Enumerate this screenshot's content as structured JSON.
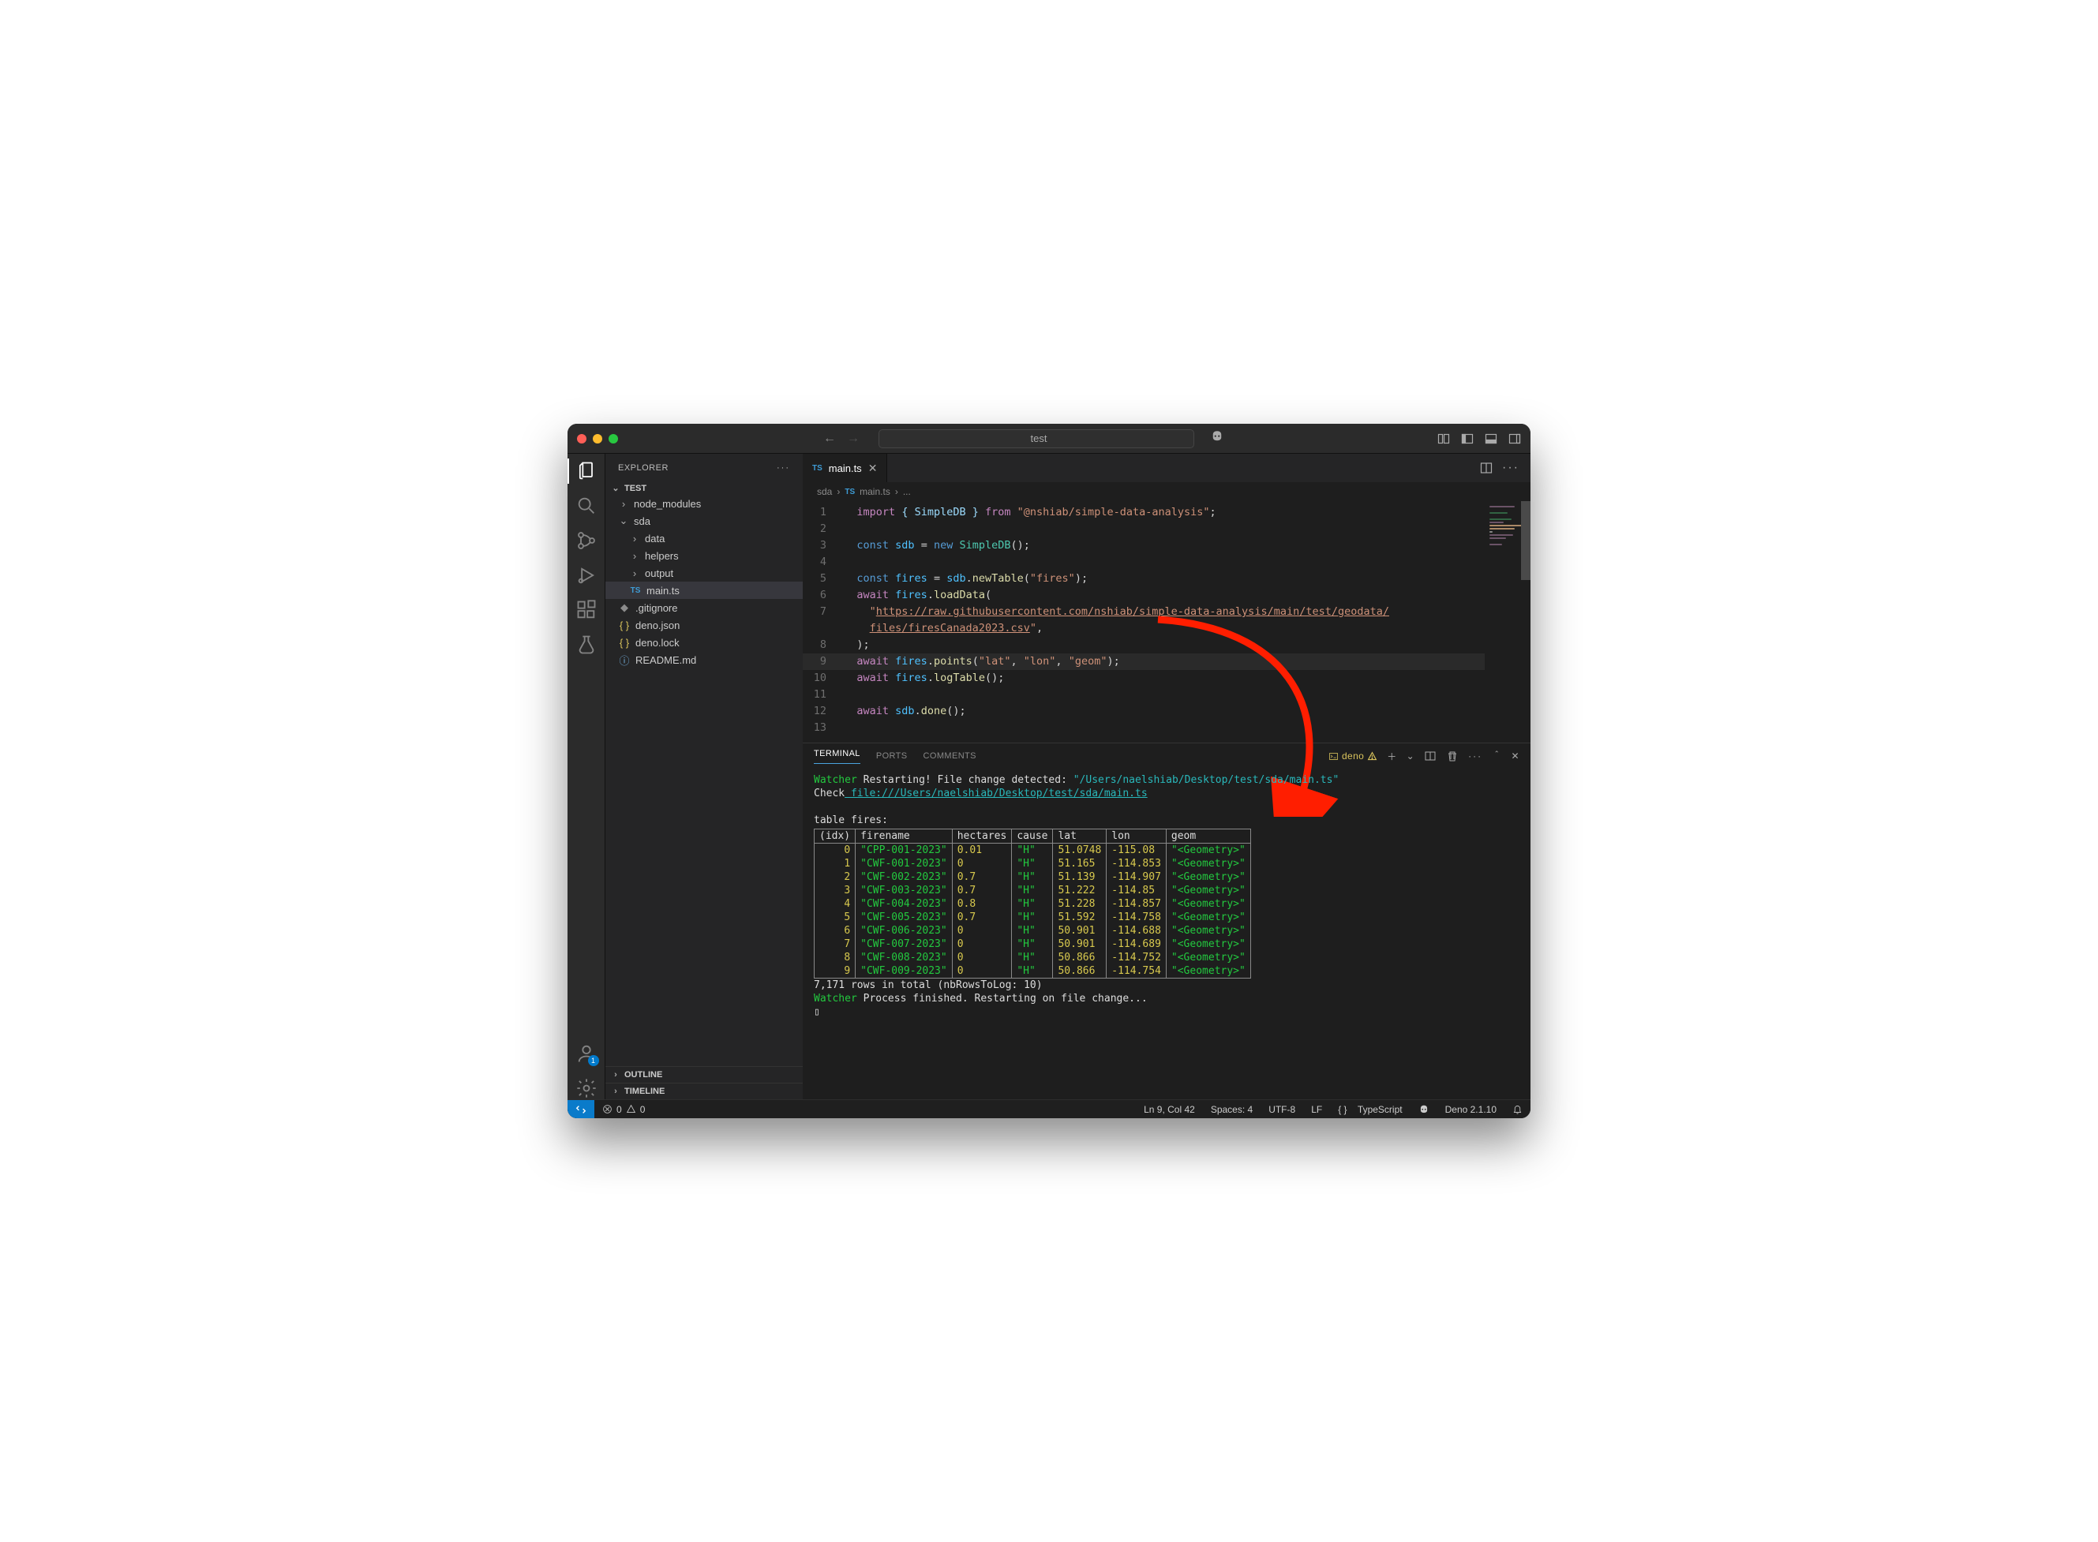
{
  "titlebar": {
    "search": "test"
  },
  "sidebar": {
    "title": "EXPLORER",
    "root": "TEST",
    "tree": [
      {
        "label": "node_modules",
        "indent": 0,
        "chev": "›"
      },
      {
        "label": "sda",
        "indent": 0,
        "chev": "⌄"
      },
      {
        "label": "data",
        "indent": 1,
        "chev": "›"
      },
      {
        "label": "helpers",
        "indent": 1,
        "chev": "›"
      },
      {
        "label": "output",
        "indent": 1,
        "chev": "›"
      },
      {
        "label": "main.ts",
        "indent": 1,
        "icon": "ts",
        "active": true
      },
      {
        "label": ".gitignore",
        "indent": 0,
        "icon": "ignore"
      },
      {
        "label": "deno.json",
        "indent": 0,
        "icon": "json"
      },
      {
        "label": "deno.lock",
        "indent": 0,
        "icon": "json"
      },
      {
        "label": "README.md",
        "indent": 0,
        "icon": "info"
      }
    ],
    "outline": "OUTLINE",
    "timeline": "TIMELINE"
  },
  "tab": {
    "label": "main.ts"
  },
  "breadcrumb": {
    "a": "sda",
    "b": "main.ts",
    "c": "..."
  },
  "editor": {
    "lines": [
      {
        "n": 1,
        "html": "<span class='k-purple'>import</span> <span class='k-prop'>{ SimpleDB }</span> <span class='k-purple'>from</span> <span class='k-str'>\"@nshiab/simple-data-analysis\"</span>;"
      },
      {
        "n": 2,
        "html": ""
      },
      {
        "n": 3,
        "html": "<span class='k-blue'>const</span> <span class='k-const'>sdb</span> = <span class='k-blue'>new</span> <span class='k-cls'>SimpleDB</span>();"
      },
      {
        "n": 4,
        "html": ""
      },
      {
        "n": 5,
        "html": "<span class='k-blue'>const</span> <span class='k-const'>fires</span> = <span class='k-const'>sdb</span>.<span class='k-fn'>newTable</span>(<span class='k-str'>\"fires\"</span>);"
      },
      {
        "n": 6,
        "html": "<span class='k-purple'>await</span> <span class='k-const'>fires</span>.<span class='k-fn'>loadData</span>("
      },
      {
        "n": 7,
        "html": "  <span class='k-str'>\"<span class='underlined'>https://raw.githubusercontent.com/nshiab/simple-data-analysis/main/test/geodata/</span></span>"
      },
      {
        "n": "",
        "html": "  <span class='k-str'><span class='underlined'>files/firesCanada2023.csv</span>\"</span>,"
      },
      {
        "n": 8,
        "html": ");"
      },
      {
        "n": 9,
        "html": "<span class='k-purple'>await</span> <span class='k-const'>fires</span>.<span class='k-fn'>points</span>(<span class='k-str'>\"lat\"</span>, <span class='k-str'>\"lon\"</span>, <span class='k-str'>\"geom\"</span>);",
        "hl": true
      },
      {
        "n": 10,
        "html": "<span class='k-purple'>await</span> <span class='k-const'>fires</span>.<span class='k-fn'>logTable</span>();"
      },
      {
        "n": 11,
        "html": ""
      },
      {
        "n": 12,
        "html": "<span class='k-purple'>await</span> <span class='k-const'>sdb</span>.<span class='k-fn'>done</span>();"
      },
      {
        "n": 13,
        "html": ""
      }
    ]
  },
  "panel": {
    "tabs": {
      "terminal": "TERMINAL",
      "ports": "PORTS",
      "comments": "COMMENTS"
    },
    "runner": "deno",
    "watcher_label": "Watcher",
    "watcher_msg": " Restarting! File change detected: ",
    "watcher_path": "\"/Users/naelshiab/Desktop/test/sda/main.ts\"",
    "check_label": "Check",
    "check_path": " file:///Users/naelshiab/Desktop/test/sda/main.ts",
    "table_label": "table fires:",
    "columns": [
      "(idx)",
      "firename",
      "hectares",
      "cause",
      "lat",
      "lon",
      "geom"
    ],
    "rows": [
      [
        0,
        "\"CPP-001-2023\"",
        "0.01",
        "\"H\"",
        "51.0748",
        "-115.08",
        "\"<Geometry>\""
      ],
      [
        1,
        "\"CWF-001-2023\"",
        "0",
        "\"H\"",
        "51.165",
        "-114.853",
        "\"<Geometry>\""
      ],
      [
        2,
        "\"CWF-002-2023\"",
        "0.7",
        "\"H\"",
        "51.139",
        "-114.907",
        "\"<Geometry>\""
      ],
      [
        3,
        "\"CWF-003-2023\"",
        "0.7",
        "\"H\"",
        "51.222",
        "-114.85",
        "\"<Geometry>\""
      ],
      [
        4,
        "\"CWF-004-2023\"",
        "0.8",
        "\"H\"",
        "51.228",
        "-114.857",
        "\"<Geometry>\""
      ],
      [
        5,
        "\"CWF-005-2023\"",
        "0.7",
        "\"H\"",
        "51.592",
        "-114.758",
        "\"<Geometry>\""
      ],
      [
        6,
        "\"CWF-006-2023\"",
        "0",
        "\"H\"",
        "50.901",
        "-114.688",
        "\"<Geometry>\""
      ],
      [
        7,
        "\"CWF-007-2023\"",
        "0",
        "\"H\"",
        "50.901",
        "-114.689",
        "\"<Geometry>\""
      ],
      [
        8,
        "\"CWF-008-2023\"",
        "0",
        "\"H\"",
        "50.866",
        "-114.752",
        "\"<Geometry>\""
      ],
      [
        9,
        "\"CWF-009-2023\"",
        "0",
        "\"H\"",
        "50.866",
        "-114.754",
        "\"<Geometry>\""
      ]
    ],
    "summary": "7,171 rows in total (nbRowsToLog: 10)",
    "watcher2": " Process finished. Restarting on file change...",
    "cursor": "▯"
  },
  "status": {
    "errors": "0",
    "warnings": "0",
    "pos": "Ln 9, Col 42",
    "spaces": "Spaces: 4",
    "enc": "UTF-8",
    "eol": "LF",
    "lang": "TypeScript",
    "deno": "Deno 2.1.10"
  },
  "account_badge": "1"
}
